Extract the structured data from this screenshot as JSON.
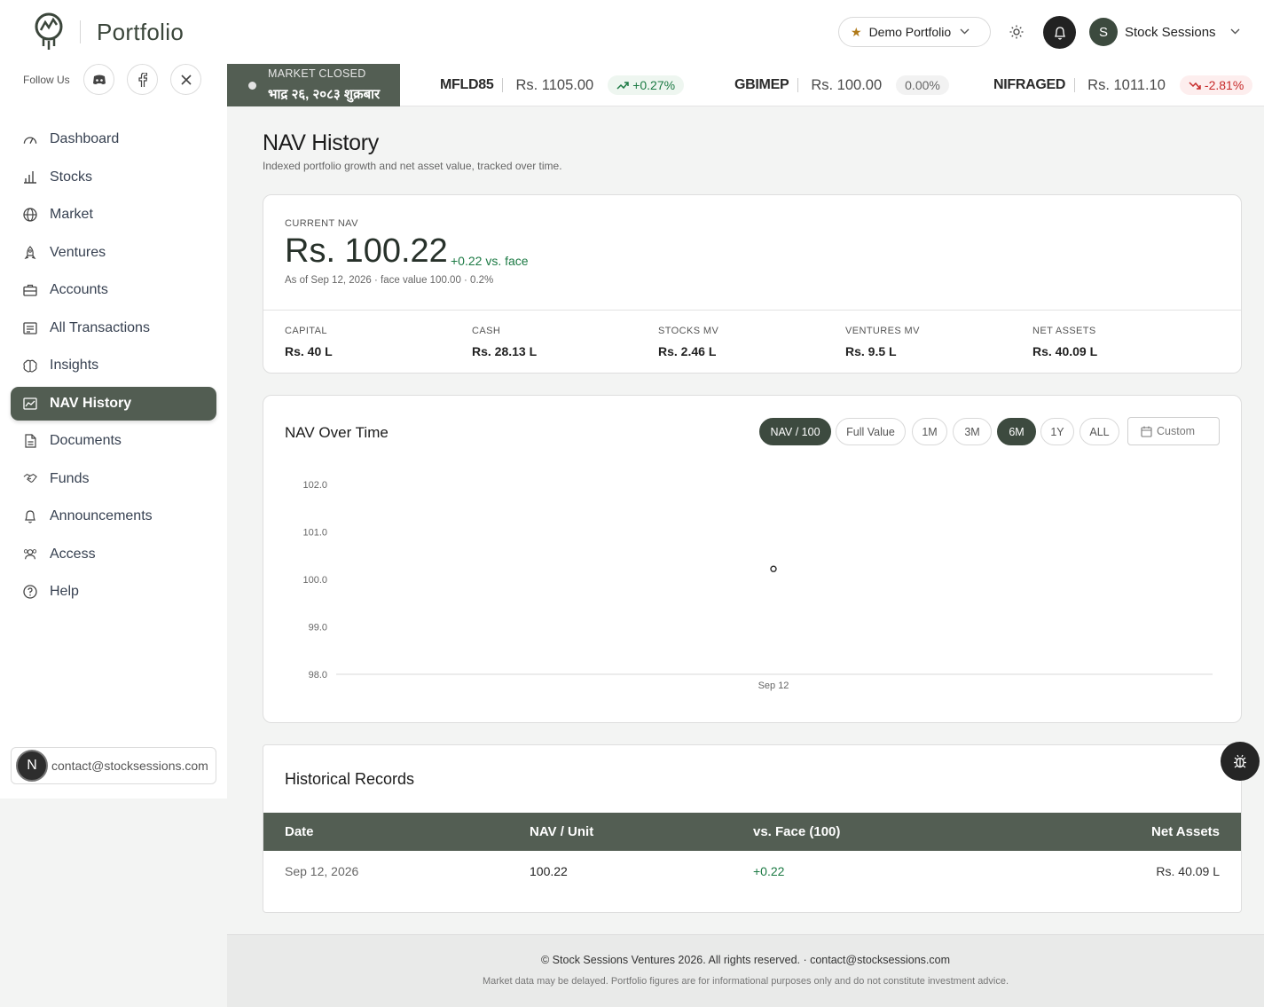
{
  "brand": {
    "name": "Portfolio"
  },
  "follow": {
    "label": "Follow Us",
    "icons": [
      "discord-icon",
      "facebook-icon",
      "x-icon"
    ]
  },
  "sidebar": {
    "items": [
      {
        "label": "Dashboard",
        "icon": "dashboard-icon"
      },
      {
        "label": "Stocks",
        "icon": "bar-chart-icon"
      },
      {
        "label": "Market",
        "icon": "globe-icon"
      },
      {
        "label": "Ventures",
        "icon": "rocket-icon"
      },
      {
        "label": "Accounts",
        "icon": "briefcase-icon"
      },
      {
        "label": "All Transactions",
        "icon": "receipt-icon"
      },
      {
        "label": "Insights",
        "icon": "brain-icon"
      },
      {
        "label": "NAV History",
        "icon": "area-chart-icon",
        "active": true
      },
      {
        "label": "Documents",
        "icon": "document-icon"
      },
      {
        "label": "Funds",
        "icon": "handshake-icon"
      },
      {
        "label": "Announcements",
        "icon": "bell-icon"
      },
      {
        "label": "Access",
        "icon": "users-icon"
      },
      {
        "label": "Help",
        "icon": "help-icon"
      }
    ],
    "user": {
      "initial": "N",
      "email": "contact@stocksessions.com"
    }
  },
  "header": {
    "portfolio_selector": "Demo Portfolio",
    "account_initial": "S",
    "account_name": "Stock Sessions"
  },
  "ticker": {
    "market_status": "MARKET CLOSED",
    "market_date": "भाद्र २६, २०८३ शुक्रबार",
    "items": [
      {
        "symbol": "MFLD85",
        "price": "Rs. 1105.00",
        "change": "+0.27%",
        "direction": "up"
      },
      {
        "symbol": "GBIMEP",
        "price": "Rs. 100.00",
        "change": "0.00%",
        "direction": "flat"
      },
      {
        "symbol": "NIFRAGED",
        "price": "Rs. 1011.10",
        "change": "-2.81%",
        "direction": "down"
      }
    ]
  },
  "page": {
    "title": "NAV History",
    "subtitle": "Indexed portfolio growth and net asset value, tracked over time."
  },
  "current_nav": {
    "label": "CURRENT NAV",
    "value": "Rs. 100.22",
    "change": "+0.22 vs. face",
    "meta": "As of Sep 12, 2026 · face value 100.00 · 0.2%",
    "stats": [
      {
        "label": "CAPITAL",
        "value": "Rs. 40 L"
      },
      {
        "label": "CASH",
        "value": "Rs. 28.13 L"
      },
      {
        "label": "STOCKS MV",
        "value": "Rs. 2.46 L"
      },
      {
        "label": "VENTURES MV",
        "value": "Rs. 9.5 L"
      },
      {
        "label": "NET ASSETS",
        "value": "Rs. 40.09 L"
      }
    ]
  },
  "chart_panel": {
    "title": "NAV Over Time",
    "mode_toggles": [
      "NAV / 100",
      "Full Value"
    ],
    "active_mode": "NAV / 100",
    "ranges": [
      "1M",
      "3M",
      "6M",
      "1Y",
      "ALL"
    ],
    "active_range": "6M",
    "custom_label": "Custom"
  },
  "chart_data": {
    "type": "line",
    "x": [
      "Sep 12"
    ],
    "series": [
      {
        "values": [
          100.22
        ]
      }
    ],
    "yticks": [
      "102.0",
      "101.0",
      "100.0",
      "99.0",
      "98.0"
    ],
    "ylim": [
      98.0,
      102.0
    ],
    "grid": false,
    "title": "",
    "xlabel": "",
    "ylabel": ""
  },
  "history": {
    "title": "Historical Records",
    "columns": [
      "Date",
      "NAV / Unit",
      "vs. Face (100)",
      "Net Assets"
    ],
    "rows": [
      {
        "date": "Sep 12, 2026",
        "nav": "100.22",
        "vs_face": "+0.22",
        "net_assets": "Rs. 40.09 L"
      }
    ]
  },
  "footer": {
    "line1": "© Stock Sessions Ventures 2026. All rights reserved. · contact@stocksessions.com",
    "line2": "Market data may be delayed. Portfolio figures are for informational purposes only and do not constitute investment advice."
  },
  "colors": {
    "accent": "#535e53",
    "positive": "#1c7a44",
    "negative": "#c72b2b"
  }
}
